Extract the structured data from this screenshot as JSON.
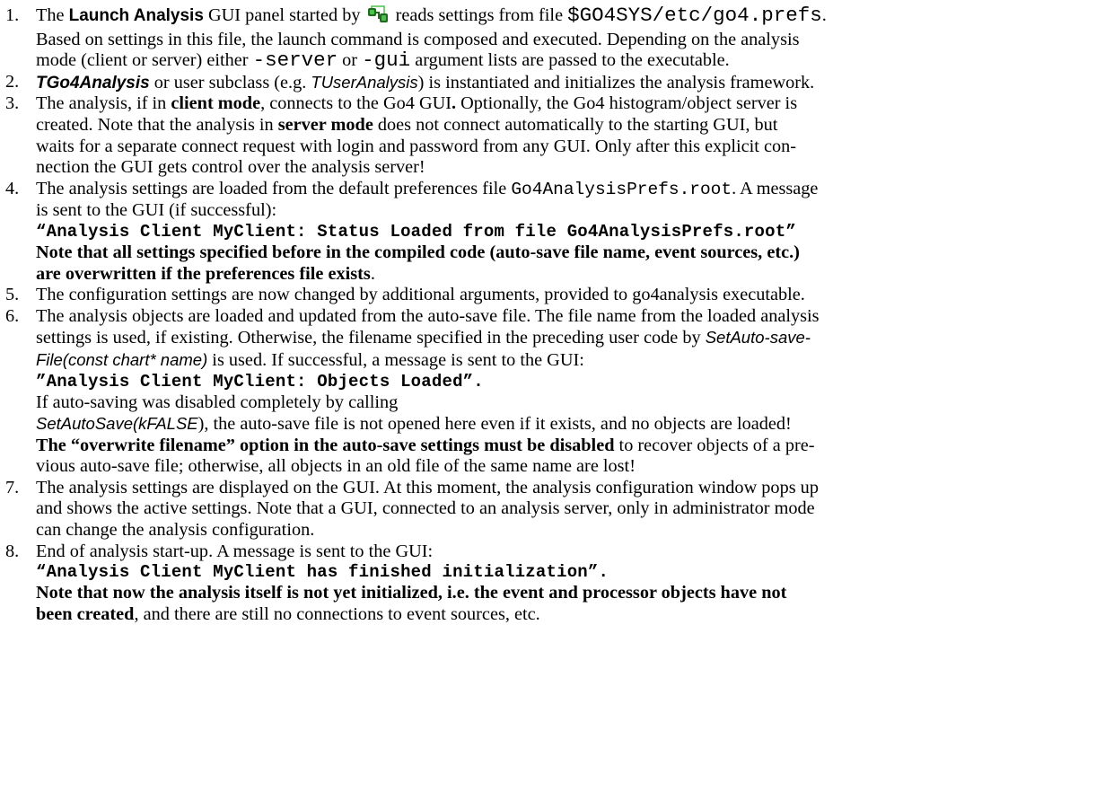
{
  "items": [
    {
      "num": "1.",
      "l1": {
        "a": "The ",
        "b": "Launch Analysis",
        "c": " GUI panel started by ",
        "d": " reads settings from file ",
        "e": "$GO4SYS/etc/go4.prefs",
        "f": "."
      },
      "l2": "Based on settings in this file, the launch command is composed and executed. Depending on the analysis",
      "l3": {
        "a": "mode (client or server) either ",
        "b": "-server",
        "c": " or ",
        "d": "-gui",
        "e": " argument lists are passed to the executable."
      }
    },
    {
      "num": "2.",
      "l1": {
        "a": "TGo4Analysis",
        "b": " or user subclass (e.g. ",
        "c": "TUserAnalysis",
        "d": ") is instantiated and initializes the analysis framework."
      }
    },
    {
      "num": "3.",
      "l1": {
        "a": "The analysis, if in ",
        "b": "client mode",
        "c": ", connects to the Go4 GUI",
        "d": ".",
        "e": " Optionally, the Go4 histogram/object server is"
      },
      "l2": {
        "a": "created. Note that the analysis in ",
        "b": "server mode",
        "c": " does not connect automatically to the starting GUI, but"
      },
      "l3": "waits for a separate connect request with login and password from any GUI. Only after this explicit con-",
      "l4": "nection the GUI gets control over the analysis server!"
    },
    {
      "num": "4.",
      "l1": {
        "a": "The analysis settings are loaded from the default preferences file ",
        "b": "Go4AnalysisPrefs.root",
        "c": ". A message"
      },
      "l2": "is sent to the GUI (if successful):",
      "l3": "“Analysis Client MyClient: Status Loaded from file Go4AnalysisPrefs.root”",
      "l4": "Note that all settings specified before in the compiled code (auto-save file name, event sources, etc.)",
      "l5": {
        "a": "are overwritten if the preferences file exists",
        "b": "."
      }
    },
    {
      "num": "5.",
      "l1": "The configuration settings are now changed by additional arguments, provided to go4analysis executable."
    },
    {
      "num": "6.",
      "l1": "The analysis objects are loaded and updated from the auto-save file. The file name from the loaded analysis",
      "l2": {
        "a": "settings is used, if existing. Otherwise, the filename specified in the preceding user code by ",
        "b": "SetAuto-save-"
      },
      "l3": {
        "a": "File(const chart* name)",
        "b": " is used. If successful, a message is sent to the GUI:"
      },
      "l4": "”Analysis Client MyClient: Objects Loaded”.",
      "l5": "If auto-saving was disabled completely by calling",
      "l6": {
        "a": "SetAutoSave(kFALSE",
        "b": "), the auto-save file is not opened here even if it exists, and no objects are loaded!"
      },
      "l7": {
        "a": "The “overwrite filename” option in the auto-save settings must be disabled",
        "b": " to recover objects of a pre-"
      },
      "l8": "vious auto-save file; otherwise, all objects in an old file of the same name are lost!"
    },
    {
      "num": "7.",
      "l1": "The analysis settings are displayed on the GUI. At this moment, the analysis configuration window pops up",
      "l2": "and shows the active settings. Note that a GUI, connected to an analysis server, only in administrator mode",
      "l3": "can change the analysis configuration."
    },
    {
      "num": "8.",
      "l1": "End of analysis start-up. A message is sent to the GUI:",
      "l2": "“Analysis Client MyClient has finished initialization”.",
      "l3": "Note that now the analysis itself is not yet initialized, i.e. the event and processor objects have not",
      "l4": {
        "a": "been created",
        "b": ", and there are still no connections to event sources, etc."
      }
    }
  ],
  "icon": {
    "name": "launch-analysis-icon",
    "color_dark": "#1f6a1f",
    "color_light": "#4cc24c"
  }
}
